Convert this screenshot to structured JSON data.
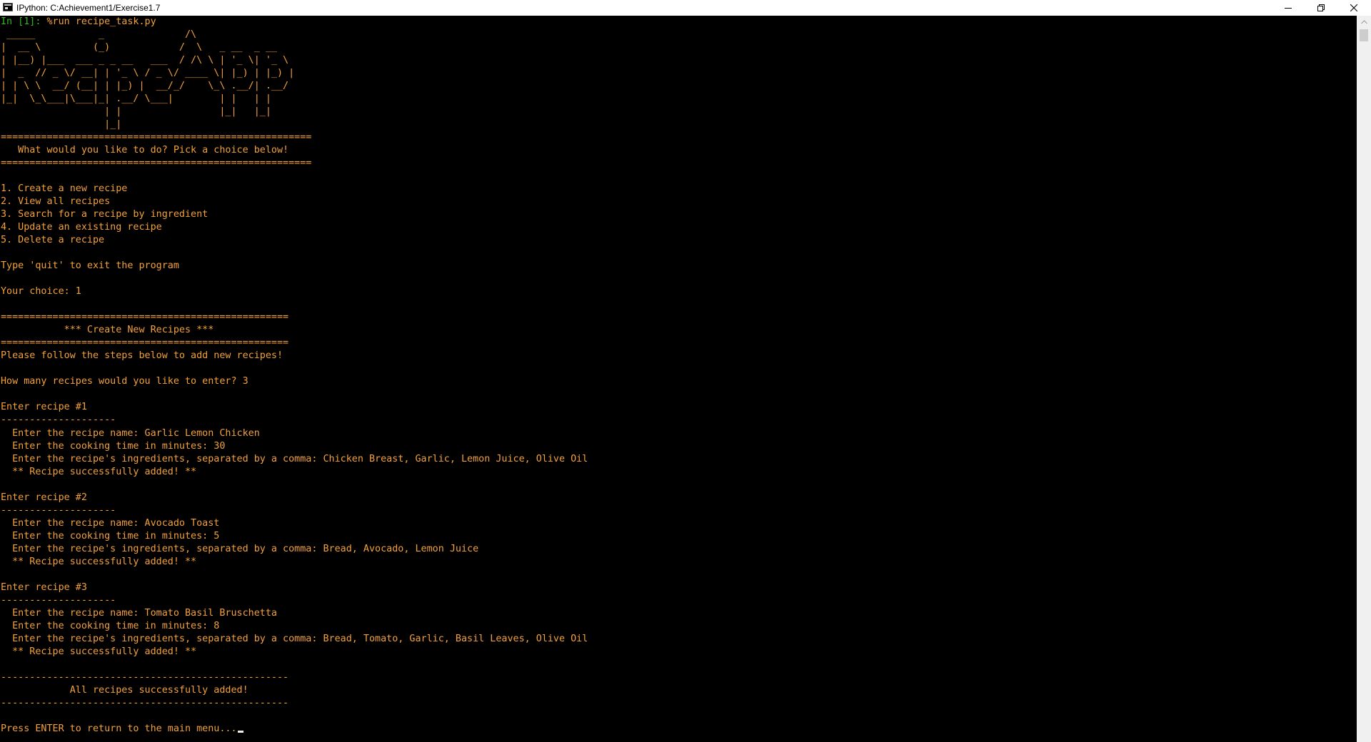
{
  "window": {
    "title": "IPython: C:Achievement1/Exercise1.7",
    "icon": "console-app-icon",
    "buttons": [
      "minimize-icon",
      "restore-icon",
      "close-icon"
    ]
  },
  "theme": {
    "background": "#000000",
    "output_color": "#f2a13b",
    "prompt_color": "#33b524",
    "cursor_color": "#f0f0f0"
  },
  "prompt": {
    "label": "In [1]:",
    "command": " %run recipe_task.py"
  },
  "banner": {
    "ascii_art": [
      " _____           _              /\\",
      "|  __ \\         (_)            /  \\   _ __  _ __",
      "| |__) |___  ___ _ _ __   ___  / /\\ \\ | '_ \\| '_ \\",
      "|  _  // _ \\/ __| | '_ \\ / _ \\/ ____ \\| |_) | |_) |",
      "| | \\ \\  __/ (__| | |_) |  __/_/    \\_\\ .__/| .__/",
      "|_|  \\_\\___|\\___|_| .__/ \\___|        | |   | |",
      "                  | |                 |_|   |_|",
      "                  |_|"
    ]
  },
  "menu": {
    "rule": "======================================================",
    "heading": "   What would you like to do? Pick a choice below!",
    "options": [
      "1. Create a new recipe",
      "2. View all recipes",
      "3. Search for a recipe by ingredient",
      "4. Update an existing recipe",
      "5. Delete a recipe"
    ],
    "quit_hint": "Type 'quit' to exit the program",
    "choice_line": "Your choice: 1"
  },
  "create": {
    "rule": "==================================================",
    "heading": "           *** Create New Recipes ***",
    "intro": "Please follow the steps below to add new recipes!",
    "count_line": "How many recipes would you like to enter? 3",
    "divider": "--------------------",
    "recipes": [
      {
        "header": "Enter recipe #1",
        "name_line": "  Enter the recipe name: Garlic Lemon Chicken",
        "time_line": "  Enter the cooking time in minutes: 30",
        "ingredients_line": "  Enter the recipe's ingredients, separated by a comma: Chicken Breast, Garlic, Lemon Juice, Olive Oil",
        "success_line": "  ** Recipe successfully added! **"
      },
      {
        "header": "Enter recipe #2",
        "name_line": "  Enter the recipe name: Avocado Toast",
        "time_line": "  Enter the cooking time in minutes: 5",
        "ingredients_line": "  Enter the recipe's ingredients, separated by a comma: Bread, Avocado, Lemon Juice",
        "success_line": "  ** Recipe successfully added! **"
      },
      {
        "header": "Enter recipe #3",
        "name_line": "  Enter the recipe name: Tomato Basil Bruschetta",
        "time_line": "  Enter the cooking time in minutes: 8",
        "ingredients_line": "  Enter the recipe's ingredients, separated by a comma: Bread, Tomato, Garlic, Basil Leaves, Olive Oil",
        "success_line": "  ** Recipe successfully added! **"
      }
    ],
    "done_rule": "--------------------------------------------------",
    "done_message": "            All recipes successfully added!",
    "return_prompt": "Press ENTER to return to the main menu..."
  }
}
